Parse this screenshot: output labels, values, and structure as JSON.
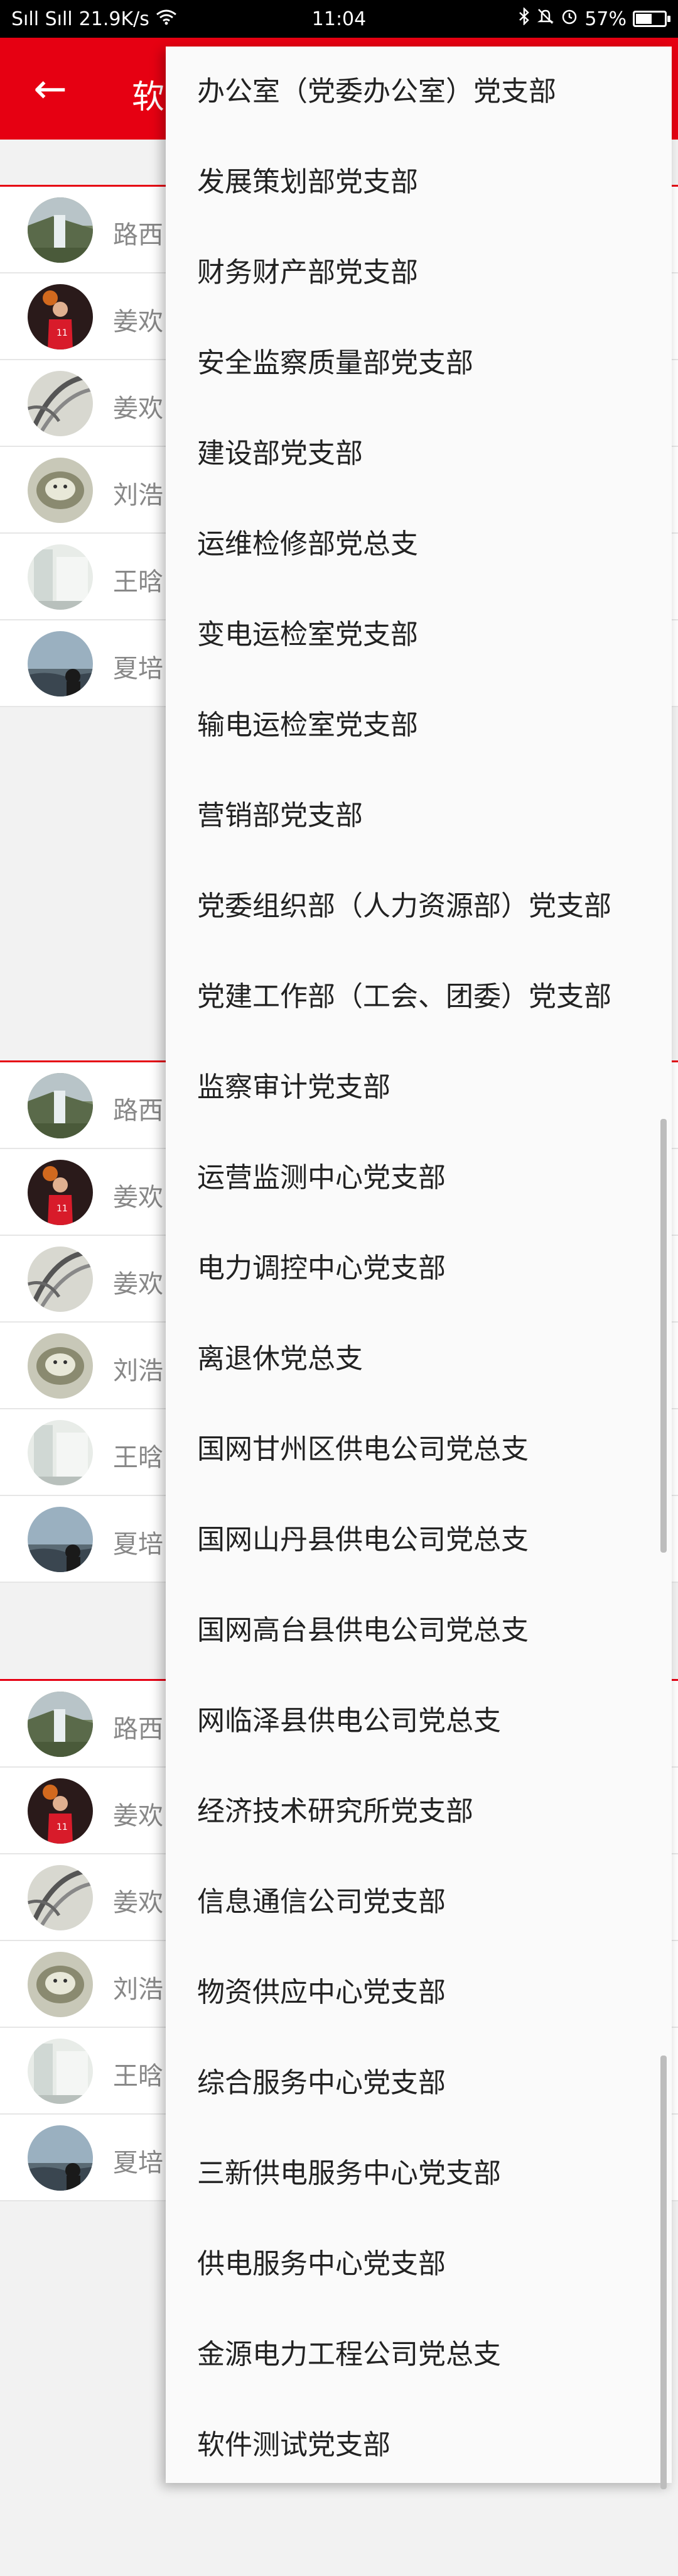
{
  "status_bar": {
    "signal": "Sıll Sıll",
    "speed": "21.9K/s",
    "wifi_icon": "wifi-icon",
    "time": "11:04",
    "icons": [
      "bluetooth-icon",
      "mute-icon",
      "alarm-icon"
    ],
    "battery_text": "57%",
    "battery_level": 0.57
  },
  "header": {
    "title": "软",
    "back_icon": "←"
  },
  "groups": [
    {
      "members": [
        {
          "name": "路西",
          "avatar": "waterfall"
        },
        {
          "name": "姜欢",
          "avatar": "basketball"
        },
        {
          "name": "姜欢",
          "avatar": "sketch"
        },
        {
          "name": "刘浩",
          "avatar": "lion"
        },
        {
          "name": "王晗",
          "avatar": "room"
        },
        {
          "name": "夏培",
          "avatar": "sunset"
        }
      ]
    },
    {
      "members": [
        {
          "name": "路西",
          "avatar": "waterfall"
        },
        {
          "name": "姜欢",
          "avatar": "basketball"
        },
        {
          "name": "姜欢",
          "avatar": "sketch"
        },
        {
          "name": "刘浩",
          "avatar": "lion"
        },
        {
          "name": "王晗",
          "avatar": "room"
        },
        {
          "name": "夏培",
          "avatar": "sunset"
        }
      ]
    },
    {
      "members": [
        {
          "name": "路西",
          "avatar": "waterfall"
        },
        {
          "name": "姜欢",
          "avatar": "basketball"
        },
        {
          "name": "姜欢",
          "avatar": "sketch"
        },
        {
          "name": "刘浩",
          "avatar": "lion"
        },
        {
          "name": "王晗",
          "avatar": "room"
        },
        {
          "name": "夏培",
          "avatar": "sunset"
        }
      ]
    }
  ],
  "dropdown": {
    "items": [
      "办公室（党委办公室）党支部",
      "发展策划部党支部",
      "财务财产部党支部",
      "安全监察质量部党支部",
      "建设部党支部",
      "运维检修部党总支",
      "变电运检室党支部",
      "输电运检室党支部",
      "营销部党支部",
      "党委组织部（人力资源部）党支部",
      "党建工作部（工会、团委）党支部",
      "监察审计党支部",
      "运营监测中心党支部",
      "电力调控中心党支部",
      "离退休党总支",
      "国网甘州区供电公司党总支",
      "国网山丹县供电公司党总支",
      "国网高台县供电公司党总支",
      "网临泽县供电公司党总支",
      "经济技术研究所党支部",
      "信息通信公司党支部",
      "物资供应中心党支部",
      "综合服务中心党支部",
      "三新供电服务中心党支部",
      "供电服务中心党支部",
      "金源电力工程公司党总支",
      "软件测试党支部"
    ]
  }
}
